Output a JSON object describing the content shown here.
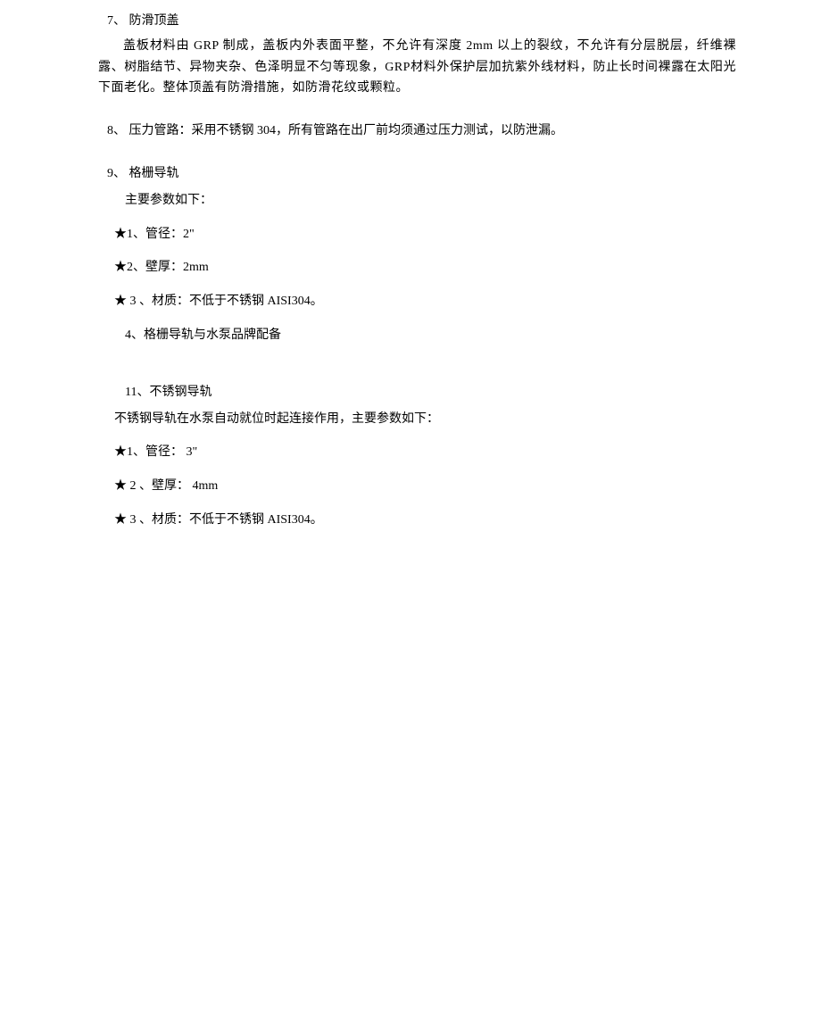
{
  "sec7": {
    "title": "7、  防滑顶盖",
    "body": "盖板材料由 GRP 制成，盖板内外表面平整，不允许有深度 2mm 以上的裂纹，不允许有分层脱层，纤维裸露、树脂结节、异物夹杂、色泽明显不匀等现象，GRP材料外保护层加抗紫外线材料，防止长时间裸露在太阳光下面老化。整体顶盖有防滑措施，如防滑花纹或颗粒。"
  },
  "sec8": {
    "title": "8、  压力管路：采用不锈钢 304，所有管路在出厂前均须通过压力测试，以防泄漏。"
  },
  "sec9": {
    "title": "9、  格栅导轨",
    "intro": "主要参数如下：",
    "p1": "★1、管径：2\"",
    "p2": "★2、壁厚：2mm",
    "p3": "★ 3 、材质：不低于不锈钢 AISI304。",
    "p4": "4、格栅导轨与水泵品牌配备"
  },
  "sec11": {
    "title": "11、不锈钢导轨",
    "intro": "不锈钢导轨在水泵自动就位时起连接作用，主要参数如下：",
    "p1": "★1、管径：  3\"",
    "p2": "★ 2 、壁厚：  4mm",
    "p3": "★ 3 、材质：不低于不锈钢 AISI304。"
  }
}
